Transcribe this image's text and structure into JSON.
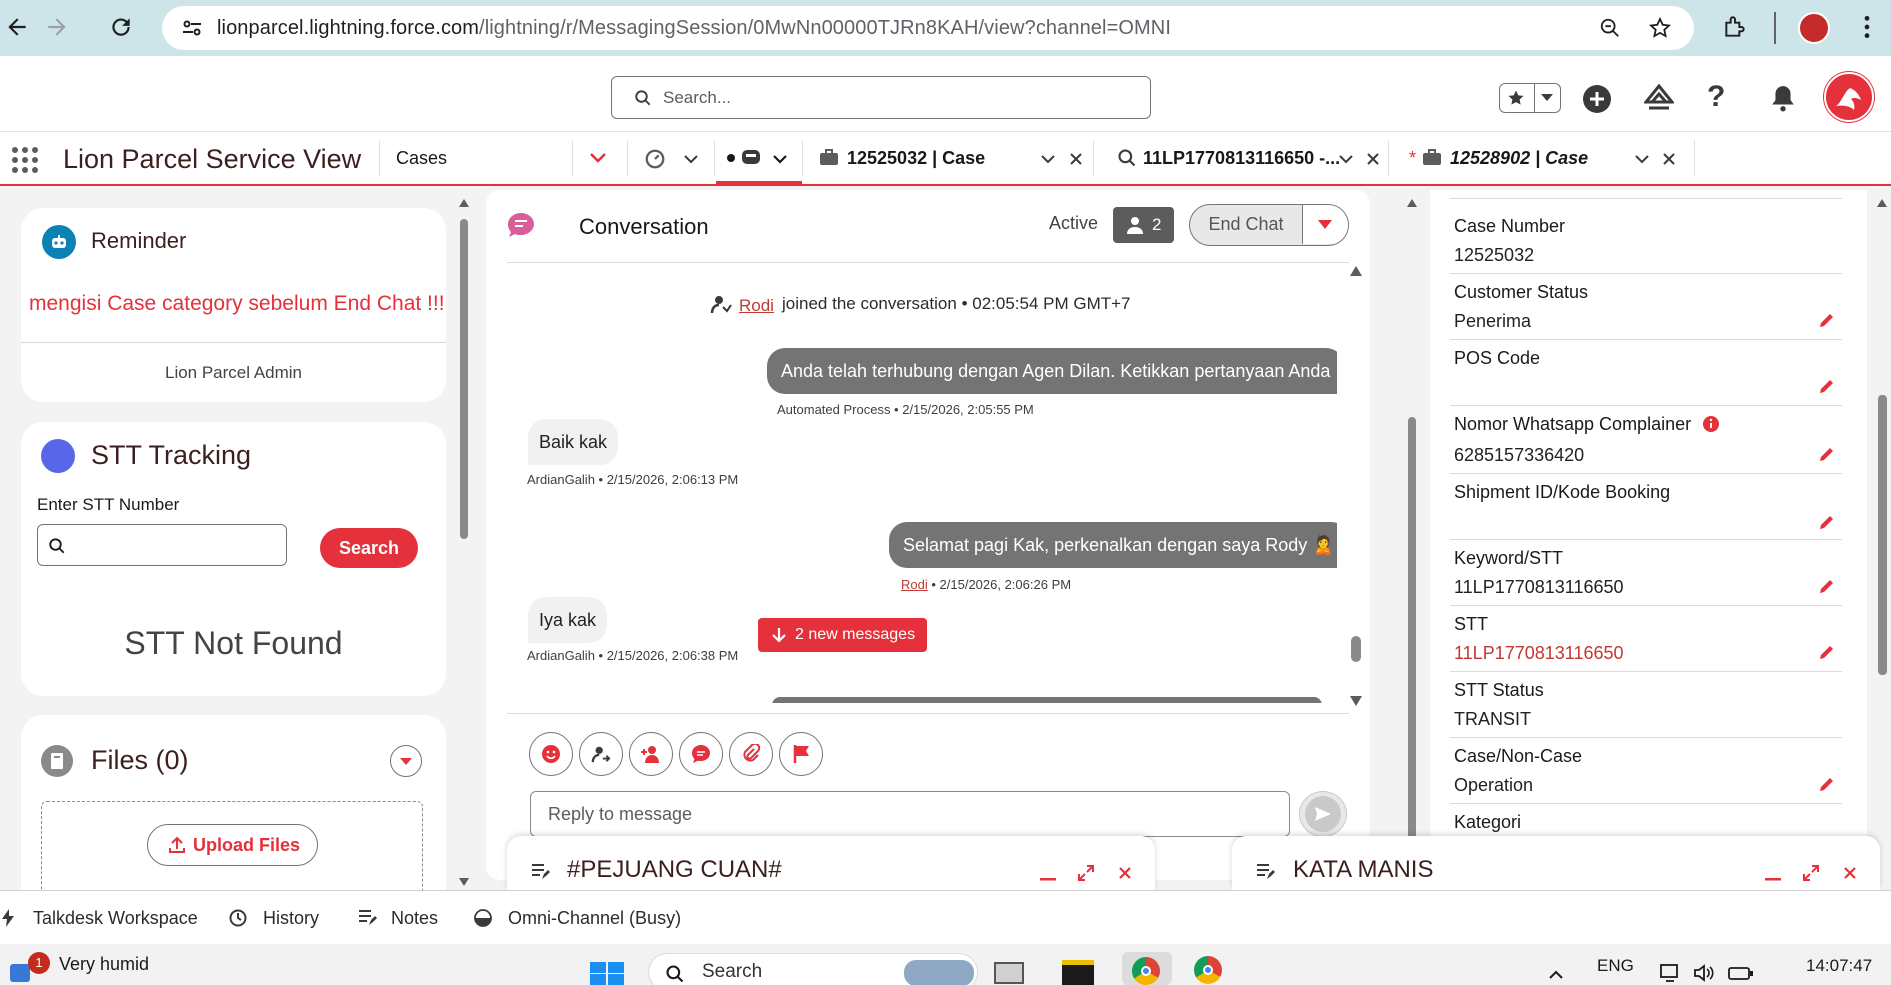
{
  "browser": {
    "url_host": "lionparcel.lightning.force.com",
    "url_path": "/lightning/r/MessagingSession/0MwNn00000TJRn8KAH/view?channel=OMNI"
  },
  "header": {
    "search_placeholder": "Search..."
  },
  "nav": {
    "app_name": "Lion Parcel Service View",
    "object_tab": "Cases",
    "tabs": [
      {
        "label": "12525032 | Case"
      },
      {
        "label": "11LP1770813116650 -..."
      },
      {
        "label": "12528902 | Case",
        "unsaved_marker": "*"
      }
    ]
  },
  "reminder": {
    "title": "Reminder",
    "message": "mengisi Case category sebelum End Chat !!!",
    "footer": "Lion Parcel Admin"
  },
  "stt_tracking": {
    "title": "STT Tracking",
    "input_label": "Enter STT Number",
    "search_button": "Search",
    "result": "STT Not Found"
  },
  "files": {
    "title": "Files (0)",
    "upload_button": "Upload Files"
  },
  "conversation": {
    "title": "Conversation",
    "status": "Active",
    "participants_count": "2",
    "end_chat": "End Chat",
    "joined_name": "Rodi",
    "joined_text": "joined the conversation • 02:05:54 PM GMT+7",
    "messages": [
      {
        "text": "Anda telah terhubung dengan Agen Dilan. Ketikkan pertanyaan Anda",
        "meta": "Automated Process • 2/15/2026, 2:05:55 PM"
      },
      {
        "text": "Baik kak",
        "meta": "ArdianGalih • 2/15/2026, 2:06:13 PM"
      },
      {
        "text": "Selamat pagi Kak, perkenalkan dengan saya Rody 🙎",
        "meta_name": "Rodi",
        "meta": " • 2/15/2026, 2:06:26 PM"
      },
      {
        "text": "Iya kak",
        "meta": "ArdianGalih • 2/15/2026, 2:06:38 PM"
      }
    ],
    "new_messages": "2 new messages",
    "reply_placeholder": "Reply to message"
  },
  "case_detail": {
    "fields": [
      {
        "label": "Case Number",
        "value": "12525032"
      },
      {
        "label": "Customer Status",
        "value": "Penerima"
      },
      {
        "label": "POS Code",
        "value": ""
      },
      {
        "label": "Nomor Whatsapp Complainer",
        "value": "6285157336420"
      },
      {
        "label": "Shipment ID/Kode Booking",
        "value": ""
      },
      {
        "label": "Keyword/STT",
        "value": "11LP1770813116650"
      },
      {
        "label": "STT",
        "value": "11LP1770813116650"
      },
      {
        "label": "STT Status",
        "value": "TRANSIT"
      },
      {
        "label": "Case/Non-Case",
        "value": "Operation"
      },
      {
        "label": "Kategori",
        "value": ""
      }
    ]
  },
  "docked": {
    "left_title": "#PEJUANG CUAN#",
    "right_title": "KATA MANIS"
  },
  "utility_bar": {
    "items": [
      "Talkdesk Workspace",
      "History",
      "Notes",
      "Omni-Channel (Busy)"
    ]
  },
  "taskbar": {
    "weather_badge": "1",
    "weather_text": "Very humid",
    "search": "Search",
    "lang": "ENG",
    "time": "14:07:47"
  }
}
